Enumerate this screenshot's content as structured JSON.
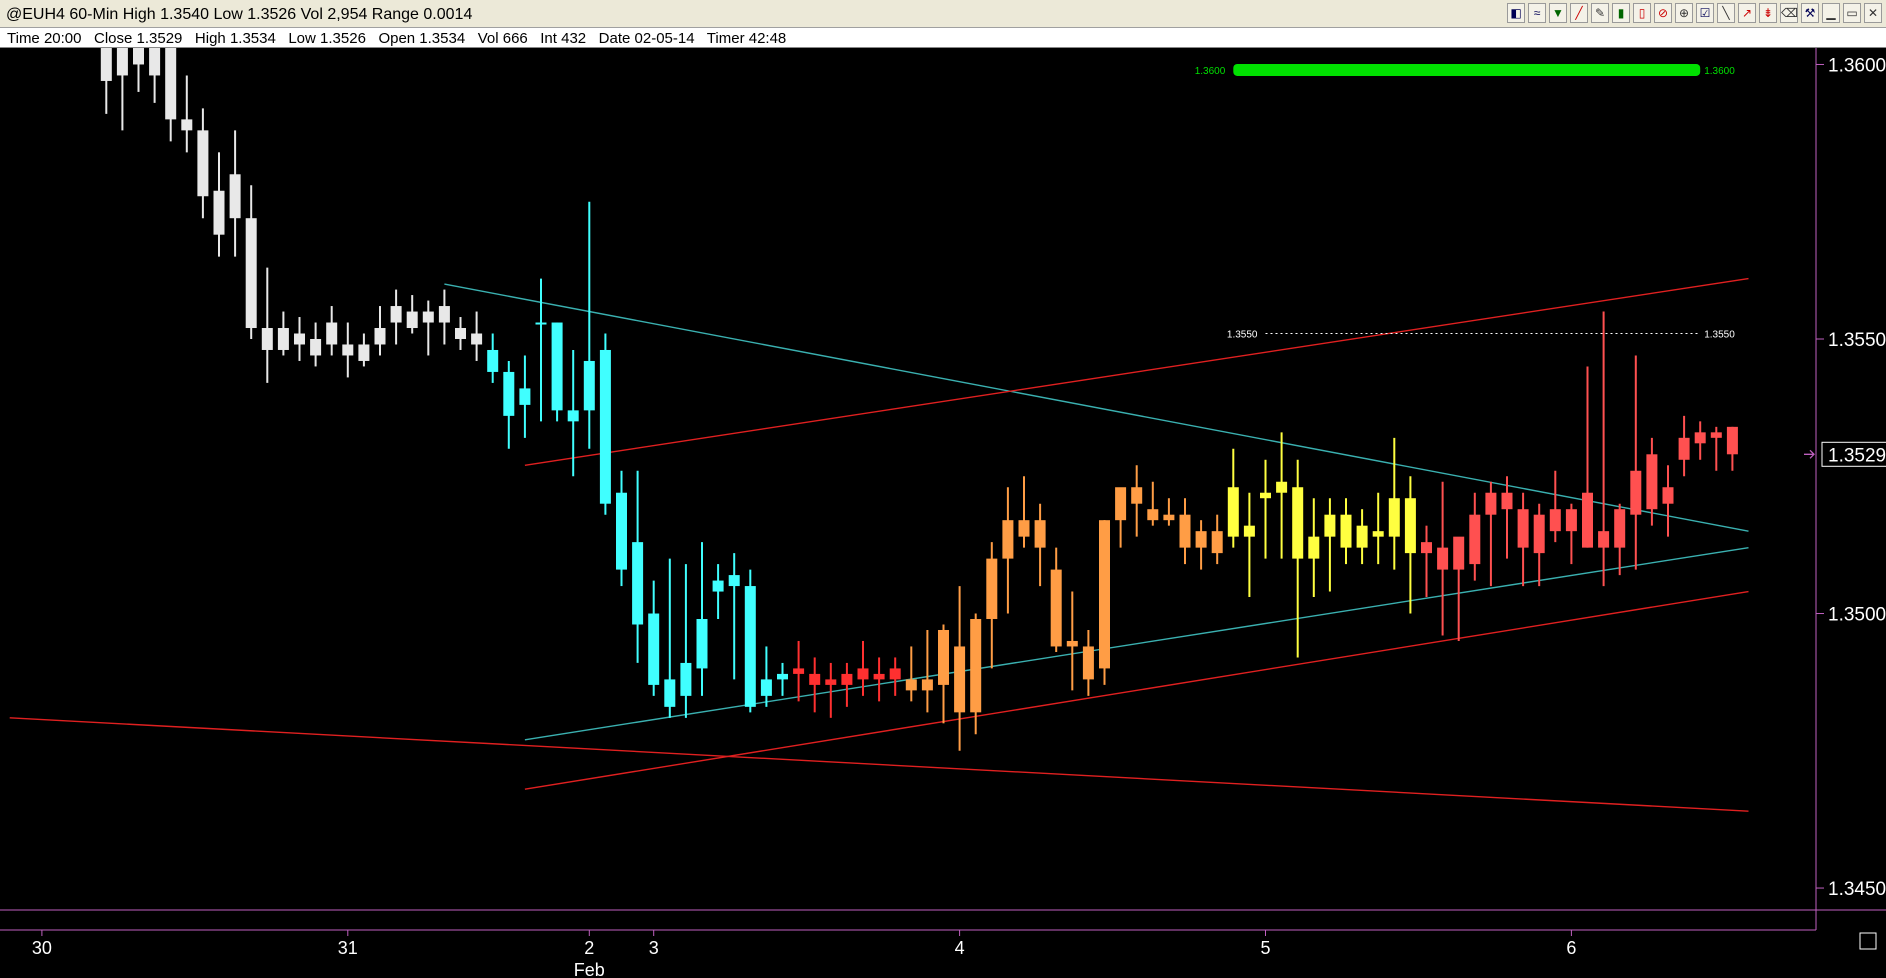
{
  "window": {
    "title": "@EUH4 60-Min High 1.3540 Low 1.3526 Vol 2,954 Range 0.0014",
    "toolbar_icons": [
      "chart-type-icon",
      "overlay-icon",
      "indicator-icon",
      "drawing-icon",
      "pencil-icon",
      "bar-icon",
      "candle-icon",
      "cursor-icon",
      "crosshair-icon",
      "settings-icon",
      "line-icon",
      "arrow-icon",
      "delete-icon",
      "trash-icon",
      "tools-icon",
      "minimize-icon",
      "restore-icon",
      "close-icon"
    ]
  },
  "info_bar": {
    "time": "Time 20:00",
    "close": "Close 1.3529",
    "high": "High 1.3534",
    "low": "Low 1.3526",
    "open": "Open 1.3534",
    "vol": "Vol 666",
    "int": "Int 432",
    "date": "Date 02-05-14",
    "timer": "Timer 42:48"
  },
  "chart_data": {
    "type": "candlestick",
    "symbol": "@EUH4",
    "interval": "60-Min",
    "ylim": [
      1.3446,
      1.3603
    ],
    "y_ticks": [
      "1.3600",
      "1.3550",
      "1.3500",
      "1.3450"
    ],
    "y_tick_values": [
      1.36,
      1.355,
      1.35,
      1.345
    ],
    "x_ticks": [
      {
        "label": "30",
        "i": -1
      },
      {
        "label": "31",
        "i": 18
      },
      {
        "label": "2",
        "i": 33
      },
      {
        "label": "3",
        "i": 37
      },
      {
        "label": "4",
        "i": 56
      },
      {
        "label": "5",
        "i": 75
      },
      {
        "label": "6",
        "i": 94
      }
    ],
    "x_sublabel": "Feb",
    "x_sublabel_i": 33,
    "last_price": "1.3529",
    "last_price_value": 1.3529,
    "levels": [
      {
        "label_left": "1.3600",
        "label_right": "1.3600",
        "value": 1.3599,
        "color": "#00e000",
        "style": "bar",
        "from_i": 73,
        "to_i": 102
      },
      {
        "label_left": "1.3550",
        "label_right": "1.3550",
        "value": 1.3551,
        "color": "#ffffff",
        "style": "dotted",
        "from_i": 75,
        "to_i": 102
      }
    ],
    "trendlines": [
      {
        "name": "cyan-upper",
        "color": "#3ab0b0",
        "from": [
          24,
          1.356
        ],
        "to": [
          105,
          1.3515
        ]
      },
      {
        "name": "cyan-lower",
        "color": "#3ab0b0",
        "from": [
          29,
          1.3477
        ],
        "to": [
          105,
          1.3512
        ]
      },
      {
        "name": "red-upper",
        "color": "#e02020",
        "from": [
          29,
          1.3527
        ],
        "to": [
          105,
          1.3561
        ]
      },
      {
        "name": "red-middle",
        "color": "#e02020",
        "from": [
          29,
          1.3468
        ],
        "to": [
          105,
          1.3504
        ]
      },
      {
        "name": "red-lower",
        "color": "#e02020",
        "from": [
          -3,
          1.3481
        ],
        "to": [
          105,
          1.3464
        ]
      }
    ],
    "series": [
      {
        "name": "white",
        "color": "#e8e8e8",
        "candles": [
          {
            "i": 3,
            "o": 1.3605,
            "h": 1.361,
            "l": 1.3591,
            "c": 1.3597
          },
          {
            "i": 4,
            "o": 1.3598,
            "h": 1.3612,
            "l": 1.3588,
            "c": 1.3607
          },
          {
            "i": 5,
            "o": 1.3607,
            "h": 1.3612,
            "l": 1.3595,
            "c": 1.36
          },
          {
            "i": 6,
            "o": 1.3604,
            "h": 1.3608,
            "l": 1.3593,
            "c": 1.3598
          },
          {
            "i": 7,
            "o": 1.3604,
            "h": 1.3606,
            "l": 1.3586,
            "c": 1.359
          },
          {
            "i": 8,
            "o": 1.359,
            "h": 1.3598,
            "l": 1.3584,
            "c": 1.3588
          },
          {
            "i": 9,
            "o": 1.3588,
            "h": 1.3592,
            "l": 1.3572,
            "c": 1.3576
          },
          {
            "i": 10,
            "o": 1.3577,
            "h": 1.3584,
            "l": 1.3565,
            "c": 1.3569
          },
          {
            "i": 11,
            "o": 1.358,
            "h": 1.3588,
            "l": 1.3565,
            "c": 1.3572
          },
          {
            "i": 12,
            "o": 1.3572,
            "h": 1.3578,
            "l": 1.355,
            "c": 1.3552
          },
          {
            "i": 13,
            "o": 1.3552,
            "h": 1.3563,
            "l": 1.3542,
            "c": 1.3548
          },
          {
            "i": 14,
            "o": 1.3548,
            "h": 1.3555,
            "l": 1.3547,
            "c": 1.3552
          },
          {
            "i": 15,
            "o": 1.3551,
            "h": 1.3554,
            "l": 1.3546,
            "c": 1.3549
          },
          {
            "i": 16,
            "o": 1.355,
            "h": 1.3553,
            "l": 1.3545,
            "c": 1.3547
          },
          {
            "i": 17,
            "o": 1.3549,
            "h": 1.3556,
            "l": 1.3547,
            "c": 1.3553
          },
          {
            "i": 18,
            "o": 1.3549,
            "h": 1.3553,
            "l": 1.3543,
            "c": 1.3547
          },
          {
            "i": 19,
            "o": 1.3546,
            "h": 1.3551,
            "l": 1.3545,
            "c": 1.3549
          },
          {
            "i": 20,
            "o": 1.3552,
            "h": 1.3556,
            "l": 1.3547,
            "c": 1.3549
          },
          {
            "i": 21,
            "o": 1.3556,
            "h": 1.3559,
            "l": 1.3549,
            "c": 1.3553
          },
          {
            "i": 22,
            "o": 1.3552,
            "h": 1.3558,
            "l": 1.3551,
            "c": 1.3555
          },
          {
            "i": 23,
            "o": 1.3553,
            "h": 1.3557,
            "l": 1.3547,
            "c": 1.3555
          },
          {
            "i": 24,
            "o": 1.3556,
            "h": 1.3559,
            "l": 1.3549,
            "c": 1.3553
          },
          {
            "i": 25,
            "o": 1.3552,
            "h": 1.3554,
            "l": 1.3548,
            "c": 1.355
          },
          {
            "i": 26,
            "o": 1.3551,
            "h": 1.3555,
            "l": 1.3546,
            "c": 1.3549
          }
        ]
      },
      {
        "name": "cyan",
        "color": "#40ffff",
        "candles": [
          {
            "i": 27,
            "o": 1.3548,
            "h": 1.3551,
            "l": 1.3542,
            "c": 1.3544
          },
          {
            "i": 28,
            "o": 1.3544,
            "h": 1.3546,
            "l": 1.353,
            "c": 1.3536
          },
          {
            "i": 29,
            "o": 1.3538,
            "h": 1.3547,
            "l": 1.3532,
            "c": 1.3541
          },
          {
            "i": 30,
            "o": 1.3553,
            "h": 1.3561,
            "l": 1.3535,
            "c": 1.3553
          },
          {
            "i": 31,
            "o": 1.3553,
            "h": 1.3553,
            "l": 1.3535,
            "c": 1.3537
          },
          {
            "i": 32,
            "o": 1.3537,
            "h": 1.3548,
            "l": 1.3525,
            "c": 1.3535
          },
          {
            "i": 33,
            "o": 1.3546,
            "h": 1.3575,
            "l": 1.353,
            "c": 1.3537
          },
          {
            "i": 34,
            "o": 1.3548,
            "h": 1.3551,
            "l": 1.3518,
            "c": 1.352
          },
          {
            "i": 35,
            "o": 1.3522,
            "h": 1.3526,
            "l": 1.3505,
            "c": 1.3508
          },
          {
            "i": 36,
            "o": 1.3513,
            "h": 1.3526,
            "l": 1.3491,
            "c": 1.3498
          },
          {
            "i": 37,
            "o": 1.35,
            "h": 1.3506,
            "l": 1.3485,
            "c": 1.3487
          },
          {
            "i": 38,
            "o": 1.3488,
            "h": 1.351,
            "l": 1.3481,
            "c": 1.3483
          },
          {
            "i": 39,
            "o": 1.3485,
            "h": 1.3509,
            "l": 1.3481,
            "c": 1.3491
          },
          {
            "i": 40,
            "o": 1.349,
            "h": 1.3513,
            "l": 1.3485,
            "c": 1.3499
          },
          {
            "i": 41,
            "o": 1.3504,
            "h": 1.3509,
            "l": 1.3499,
            "c": 1.3506
          },
          {
            "i": 42,
            "o": 1.3505,
            "h": 1.3511,
            "l": 1.3488,
            "c": 1.3507
          },
          {
            "i": 43,
            "o": 1.3505,
            "h": 1.3508,
            "l": 1.3482,
            "c": 1.3483
          },
          {
            "i": 44,
            "o": 1.3485,
            "h": 1.3494,
            "l": 1.3483,
            "c": 1.3488
          },
          {
            "i": 45,
            "o": 1.3488,
            "h": 1.3491,
            "l": 1.3485,
            "c": 1.3489
          }
        ]
      },
      {
        "name": "red-left",
        "color": "#ff3030",
        "candles": [
          {
            "i": 46,
            "o": 1.3489,
            "h": 1.3495,
            "l": 1.3484,
            "c": 1.349
          },
          {
            "i": 47,
            "o": 1.3489,
            "h": 1.3492,
            "l": 1.3482,
            "c": 1.3487
          },
          {
            "i": 48,
            "o": 1.3488,
            "h": 1.3491,
            "l": 1.3481,
            "c": 1.3487
          },
          {
            "i": 49,
            "o": 1.3489,
            "h": 1.3491,
            "l": 1.3483,
            "c": 1.3487
          },
          {
            "i": 50,
            "o": 1.3488,
            "h": 1.3495,
            "l": 1.3485,
            "c": 1.349
          },
          {
            "i": 51,
            "o": 1.3489,
            "h": 1.3492,
            "l": 1.3484,
            "c": 1.3488
          },
          {
            "i": 52,
            "o": 1.349,
            "h": 1.3492,
            "l": 1.3485,
            "c": 1.3488
          }
        ]
      },
      {
        "name": "orange",
        "color": "#ff9d45",
        "candles": [
          {
            "i": 53,
            "o": 1.3488,
            "h": 1.3494,
            "l": 1.3484,
            "c": 1.3486
          },
          {
            "i": 54,
            "o": 1.3486,
            "h": 1.3497,
            "l": 1.3482,
            "c": 1.3488
          },
          {
            "i": 55,
            "o": 1.3487,
            "h": 1.3498,
            "l": 1.348,
            "c": 1.3497
          },
          {
            "i": 56,
            "o": 1.3494,
            "h": 1.3505,
            "l": 1.3475,
            "c": 1.3482
          },
          {
            "i": 57,
            "o": 1.3482,
            "h": 1.35,
            "l": 1.3478,
            "c": 1.3499
          },
          {
            "i": 58,
            "o": 1.3499,
            "h": 1.3513,
            "l": 1.349,
            "c": 1.351
          },
          {
            "i": 59,
            "o": 1.351,
            "h": 1.3523,
            "l": 1.35,
            "c": 1.3517
          },
          {
            "i": 60,
            "o": 1.3517,
            "h": 1.3525,
            "l": 1.3512,
            "c": 1.3514
          },
          {
            "i": 61,
            "o": 1.3517,
            "h": 1.352,
            "l": 1.3505,
            "c": 1.3512
          },
          {
            "i": 62,
            "o": 1.3508,
            "h": 1.3512,
            "l": 1.3493,
            "c": 1.3494
          },
          {
            "i": 63,
            "o": 1.3494,
            "h": 1.3504,
            "l": 1.3486,
            "c": 1.3495
          },
          {
            "i": 64,
            "o": 1.3494,
            "h": 1.3497,
            "l": 1.3485,
            "c": 1.3488
          },
          {
            "i": 65,
            "o": 1.349,
            "h": 1.3517,
            "l": 1.3487,
            "c": 1.3517
          },
          {
            "i": 66,
            "o": 1.3517,
            "h": 1.3522,
            "l": 1.3512,
            "c": 1.3523
          },
          {
            "i": 67,
            "o": 1.3523,
            "h": 1.3527,
            "l": 1.3514,
            "c": 1.352
          },
          {
            "i": 68,
            "o": 1.3519,
            "h": 1.3524,
            "l": 1.3516,
            "c": 1.3517
          },
          {
            "i": 69,
            "o": 1.3517,
            "h": 1.3521,
            "l": 1.3516,
            "c": 1.3518
          },
          {
            "i": 70,
            "o": 1.3518,
            "h": 1.3521,
            "l": 1.3509,
            "c": 1.3512
          },
          {
            "i": 71,
            "o": 1.3512,
            "h": 1.3517,
            "l": 1.3508,
            "c": 1.3515
          },
          {
            "i": 72,
            "o": 1.3515,
            "h": 1.3518,
            "l": 1.3509,
            "c": 1.3511
          }
        ]
      },
      {
        "name": "yellow",
        "color": "#ffff40",
        "candles": [
          {
            "i": 73,
            "o": 1.3523,
            "h": 1.353,
            "l": 1.3512,
            "c": 1.3514
          },
          {
            "i": 74,
            "o": 1.3514,
            "h": 1.3522,
            "l": 1.3503,
            "c": 1.3516
          },
          {
            "i": 75,
            "o": 1.3521,
            "h": 1.3528,
            "l": 1.351,
            "c": 1.3522
          },
          {
            "i": 76,
            "o": 1.3524,
            "h": 1.3533,
            "l": 1.351,
            "c": 1.3522
          },
          {
            "i": 77,
            "o": 1.3523,
            "h": 1.3528,
            "l": 1.3492,
            "c": 1.351
          },
          {
            "i": 78,
            "o": 1.351,
            "h": 1.3521,
            "l": 1.3503,
            "c": 1.3514
          },
          {
            "i": 79,
            "o": 1.3514,
            "h": 1.3521,
            "l": 1.3504,
            "c": 1.3518
          },
          {
            "i": 80,
            "o": 1.3518,
            "h": 1.3521,
            "l": 1.3509,
            "c": 1.3512
          },
          {
            "i": 81,
            "o": 1.3512,
            "h": 1.3519,
            "l": 1.3509,
            "c": 1.3516
          },
          {
            "i": 82,
            "o": 1.3515,
            "h": 1.3522,
            "l": 1.3509,
            "c": 1.3514
          },
          {
            "i": 83,
            "o": 1.3514,
            "h": 1.3532,
            "l": 1.3508,
            "c": 1.3521
          },
          {
            "i": 84,
            "o": 1.3521,
            "h": 1.3525,
            "l": 1.35,
            "c": 1.3511
          }
        ]
      },
      {
        "name": "red-right",
        "color": "#ff5050",
        "candles": [
          {
            "i": 85,
            "o": 1.3511,
            "h": 1.3516,
            "l": 1.3503,
            "c": 1.3513
          },
          {
            "i": 86,
            "o": 1.3512,
            "h": 1.3524,
            "l": 1.3496,
            "c": 1.3508
          },
          {
            "i": 87,
            "o": 1.3508,
            "h": 1.3512,
            "l": 1.3495,
            "c": 1.3514
          },
          {
            "i": 88,
            "o": 1.3509,
            "h": 1.3522,
            "l": 1.3506,
            "c": 1.3518
          },
          {
            "i": 89,
            "o": 1.3518,
            "h": 1.3524,
            "l": 1.3505,
            "c": 1.3522
          },
          {
            "i": 90,
            "o": 1.3522,
            "h": 1.3525,
            "l": 1.351,
            "c": 1.3519
          },
          {
            "i": 91,
            "o": 1.3519,
            "h": 1.3522,
            "l": 1.3505,
            "c": 1.3512
          },
          {
            "i": 92,
            "o": 1.3511,
            "h": 1.352,
            "l": 1.3505,
            "c": 1.3518
          },
          {
            "i": 93,
            "o": 1.3519,
            "h": 1.3526,
            "l": 1.3513,
            "c": 1.3515
          },
          {
            "i": 94,
            "o": 1.3515,
            "h": 1.352,
            "l": 1.3509,
            "c": 1.3519
          },
          {
            "i": 95,
            "o": 1.3522,
            "h": 1.3545,
            "l": 1.3512,
            "c": 1.3512
          },
          {
            "i": 96,
            "o": 1.3515,
            "h": 1.3555,
            "l": 1.3505,
            "c": 1.3512
          },
          {
            "i": 97,
            "o": 1.3512,
            "h": 1.352,
            "l": 1.3507,
            "c": 1.3519
          },
          {
            "i": 98,
            "o": 1.3518,
            "h": 1.3547,
            "l": 1.3508,
            "c": 1.3526
          },
          {
            "i": 99,
            "o": 1.3529,
            "h": 1.3532,
            "l": 1.3516,
            "c": 1.3519
          },
          {
            "i": 100,
            "o": 1.352,
            "h": 1.3527,
            "l": 1.3514,
            "c": 1.3523
          },
          {
            "i": 101,
            "o": 1.3528,
            "h": 1.3536,
            "l": 1.3525,
            "c": 1.3532
          },
          {
            "i": 102,
            "o": 1.3533,
            "h": 1.3535,
            "l": 1.3528,
            "c": 1.3531
          },
          {
            "i": 103,
            "o": 1.3533,
            "h": 1.3534,
            "l": 1.3526,
            "c": 1.3532
          },
          {
            "i": 104,
            "o": 1.3534,
            "h": 1.3534,
            "l": 1.3526,
            "c": 1.3529
          }
        ]
      }
    ]
  }
}
